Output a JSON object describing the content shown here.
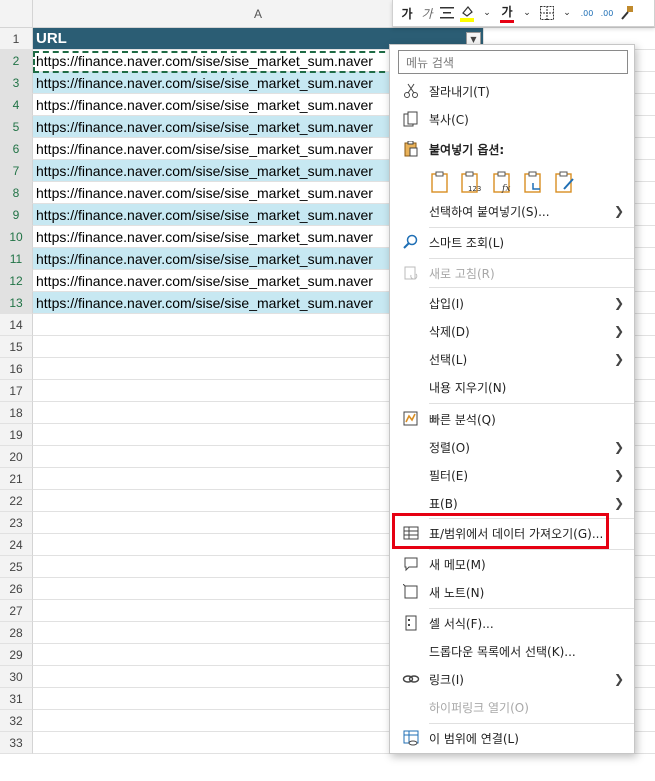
{
  "column_header": "A",
  "rows": [
    {
      "num": "1",
      "value": "URL"
    },
    {
      "num": "2",
      "value": "https://finance.naver.com/sise/sise_market_sum.naver"
    },
    {
      "num": "3",
      "value": "https://finance.naver.com/sise/sise_market_sum.naver"
    },
    {
      "num": "4",
      "value": "https://finance.naver.com/sise/sise_market_sum.naver"
    },
    {
      "num": "5",
      "value": "https://finance.naver.com/sise/sise_market_sum.naver"
    },
    {
      "num": "6",
      "value": "https://finance.naver.com/sise/sise_market_sum.naver"
    },
    {
      "num": "7",
      "value": "https://finance.naver.com/sise/sise_market_sum.naver"
    },
    {
      "num": "8",
      "value": "https://finance.naver.com/sise/sise_market_sum.naver"
    },
    {
      "num": "9",
      "value": "https://finance.naver.com/sise/sise_market_sum.naver"
    },
    {
      "num": "10",
      "value": "https://finance.naver.com/sise/sise_market_sum.naver"
    },
    {
      "num": "11",
      "value": "https://finance.naver.com/sise/sise_market_sum.naver"
    },
    {
      "num": "12",
      "value": "https://finance.naver.com/sise/sise_market_sum.naver"
    },
    {
      "num": "13",
      "value": "https://finance.naver.com/sise/sise_market_sum.naver"
    },
    {
      "num": "14",
      "value": ""
    },
    {
      "num": "15",
      "value": ""
    },
    {
      "num": "16",
      "value": ""
    },
    {
      "num": "17",
      "value": ""
    },
    {
      "num": "18",
      "value": ""
    },
    {
      "num": "19",
      "value": ""
    },
    {
      "num": "20",
      "value": ""
    },
    {
      "num": "21",
      "value": ""
    },
    {
      "num": "22",
      "value": ""
    },
    {
      "num": "23",
      "value": ""
    },
    {
      "num": "24",
      "value": ""
    },
    {
      "num": "25",
      "value": ""
    },
    {
      "num": "26",
      "value": ""
    },
    {
      "num": "27",
      "value": ""
    },
    {
      "num": "28",
      "value": ""
    },
    {
      "num": "29",
      "value": ""
    },
    {
      "num": "30",
      "value": ""
    },
    {
      "num": "31",
      "value": ""
    },
    {
      "num": "32",
      "value": ""
    },
    {
      "num": "33",
      "value": ""
    }
  ],
  "mini_toolbar": {
    "bold": "가",
    "italic": "가",
    "font_color": "가",
    "dec_decimal": ".00",
    "inc_decimal": ".00"
  },
  "menu": {
    "search_placeholder": "메뉴 검색",
    "cut": "잘라내기(T)",
    "copy": "복사(C)",
    "paste_options": "붙여넣기 옵션:",
    "paste_special": "선택하여 붙여넣기(S)...",
    "smart_lookup": "스마트 조회(L)",
    "refresh": "새로 고침(R)",
    "insert": "삽입(I)",
    "delete": "삭제(D)",
    "select": "선택(L)",
    "clear": "내용 지우기(N)",
    "quick_analysis": "빠른 분석(Q)",
    "sort": "정렬(O)",
    "filter": "필터(E)",
    "table": "표(B)",
    "get_data": "표/범위에서 데이터 가져오기(G)...",
    "new_comment": "새 메모(M)",
    "new_note": "새 노트(N)",
    "format_cells": "셀 서식(F)...",
    "dropdown": "드롭다운 목록에서 선택(K)...",
    "link": "링크(I)",
    "open_hyperlink": "하이퍼링크 열기(O)",
    "link_to_range": "이 범위에 연결(L)"
  },
  "colors": {
    "header_fill": "#2b5d74",
    "band_fill": "#c7e8f2",
    "highlight": "#e60012"
  }
}
